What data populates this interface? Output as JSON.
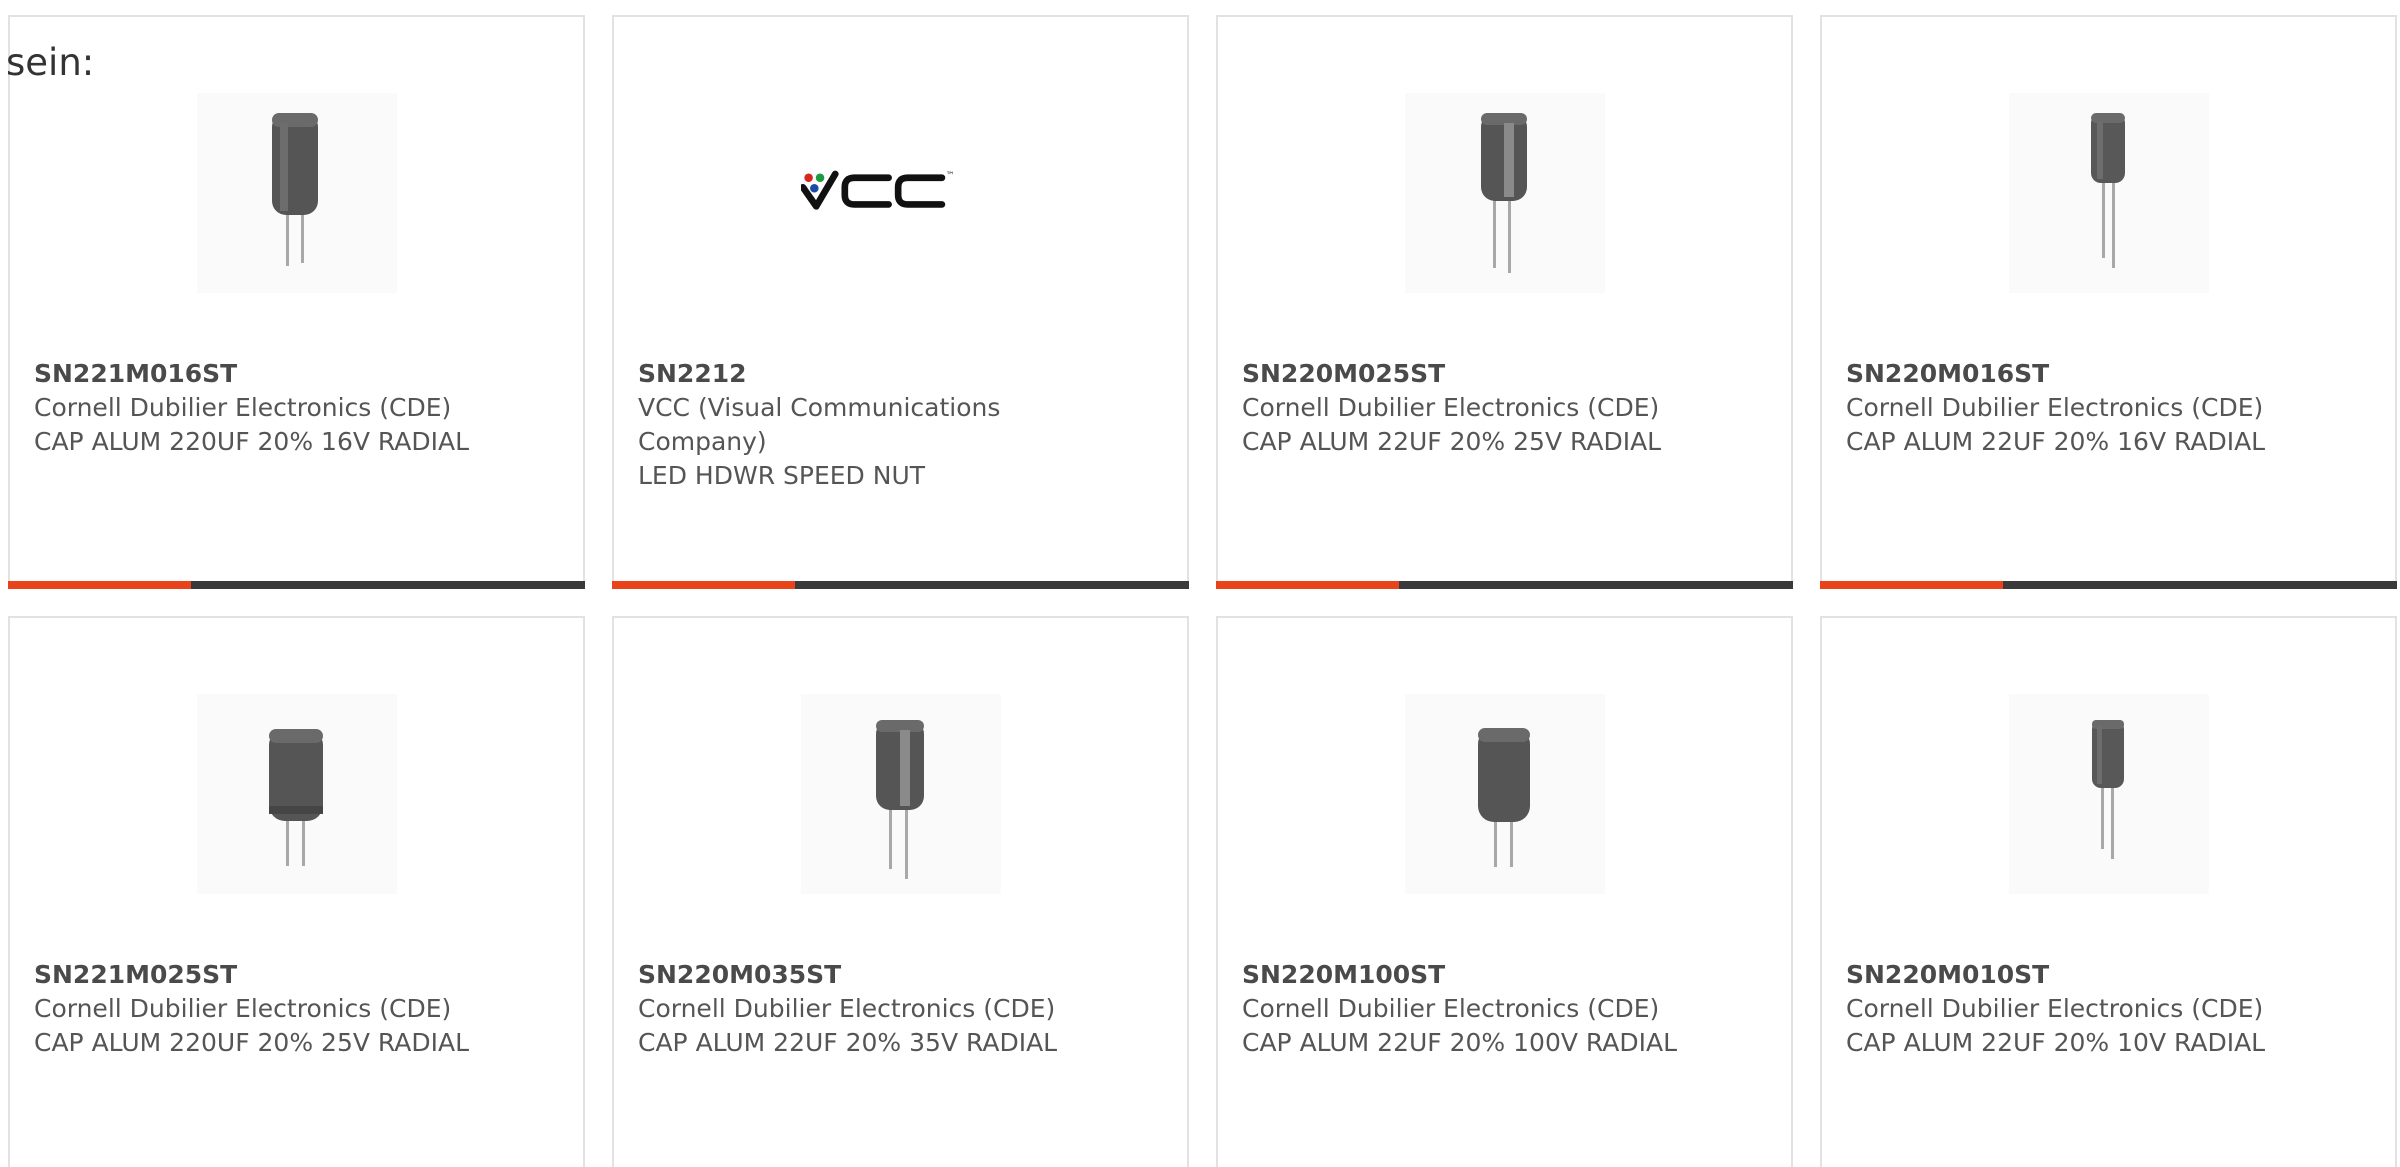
{
  "intro_text": "sein:",
  "accent_color": "#e8431a",
  "products": [
    {
      "part_number": "SN221M016ST",
      "manufacturer": "Cornell Dubilier Electronics (CDE)",
      "description": "CAP ALUM 220UF 20% 16V RADIAL",
      "image": "capacitor-image",
      "show_bar": true
    },
    {
      "part_number": "SN2212",
      "manufacturer": "VCC (Visual Communications Company)",
      "description": "LED HDWR SPEED NUT",
      "image": "vcc-logo",
      "show_bar": true
    },
    {
      "part_number": "SN220M025ST",
      "manufacturer": "Cornell Dubilier Electronics (CDE)",
      "description": "CAP ALUM 22UF 20% 25V RADIAL",
      "image": "capacitor-image",
      "show_bar": true
    },
    {
      "part_number": "SN220M016ST",
      "manufacturer": "Cornell Dubilier Electronics (CDE)",
      "description": "CAP ALUM 22UF 20% 16V RADIAL",
      "image": "capacitor-image",
      "show_bar": true
    },
    {
      "part_number": "SN221M025ST",
      "manufacturer": "Cornell Dubilier Electronics (CDE)",
      "description": "CAP ALUM 220UF 20% 25V RADIAL",
      "image": "capacitor-image",
      "show_bar": false
    },
    {
      "part_number": "SN220M035ST",
      "manufacturer": "Cornell Dubilier Electronics (CDE)",
      "description": "CAP ALUM 22UF 20% 35V RADIAL",
      "image": "capacitor-image",
      "show_bar": false
    },
    {
      "part_number": "SN220M100ST",
      "manufacturer": "Cornell Dubilier Electronics (CDE)",
      "description": "CAP ALUM 22UF 20% 100V RADIAL",
      "image": "capacitor-image",
      "show_bar": false
    },
    {
      "part_number": "SN220M010ST",
      "manufacturer": "Cornell Dubilier Electronics (CDE)",
      "description": "CAP ALUM 22UF 20% 10V RADIAL",
      "image": "capacitor-image",
      "show_bar": false
    }
  ]
}
